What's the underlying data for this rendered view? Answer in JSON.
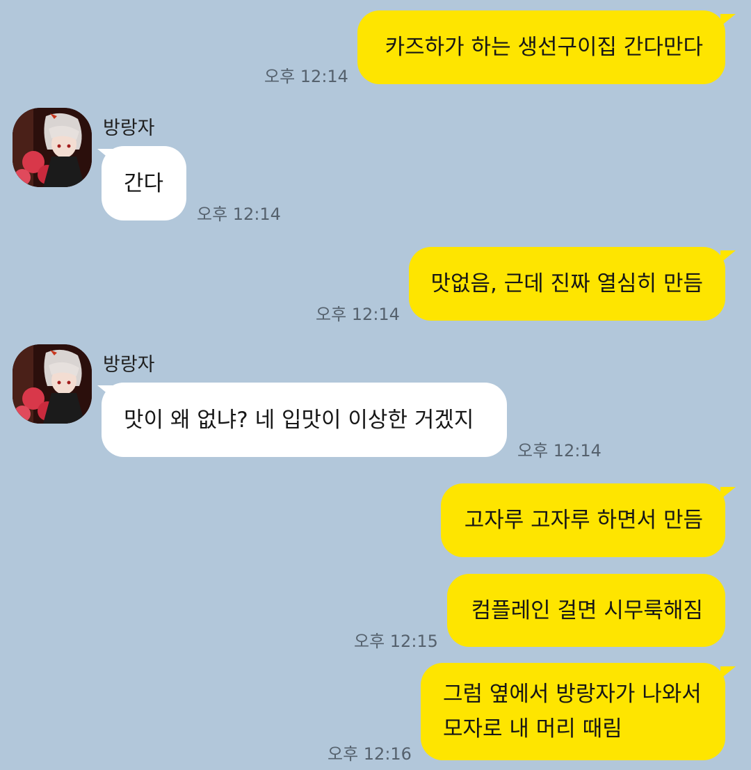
{
  "messages": [
    {
      "side": "me",
      "text": "카즈하가 하는 생선구이집 간다만다",
      "time": "오후 12:14"
    },
    {
      "side": "them",
      "sender": "방랑자",
      "avatar": "avatar-kazuha-icon",
      "text": "간다",
      "time": "오후 12:14"
    },
    {
      "side": "me",
      "text": "맛없음, 근데 진짜 열심히 만듬",
      "time": "오후 12:14"
    },
    {
      "side": "them",
      "sender": "방랑자",
      "avatar": "avatar-kazuha-icon",
      "text": "맛이 왜 없냐? 네 입맛이 이상한 거겠지",
      "time": "오후 12:14"
    },
    {
      "side": "me",
      "text": "고자루 고자루 하면서 만듬"
    },
    {
      "side": "me",
      "text": "컴플레인 걸면 시무룩해짐",
      "time": "오후 12:15"
    },
    {
      "side": "me",
      "lines": [
        "그럼 옆에서 방랑자가 나와서",
        "모자로 내 머리 때림"
      ],
      "time": "오후 12:16"
    }
  ],
  "colors": {
    "background": "#b2c7da",
    "my_bubble": "#fee500",
    "their_bubble": "#ffffff"
  }
}
